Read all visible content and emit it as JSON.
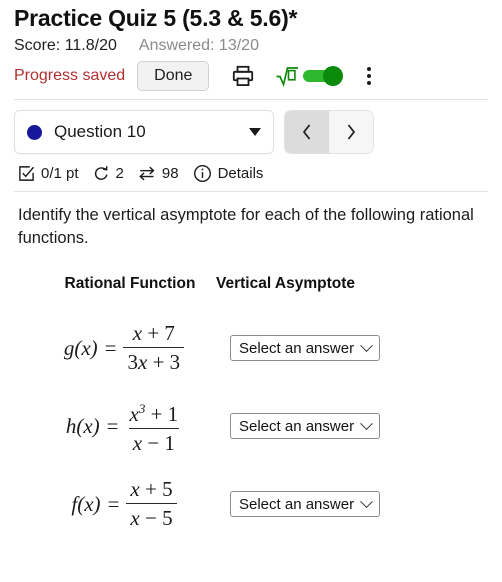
{
  "header": {
    "title": "Practice Quiz 5 (5.3 & 5.6)*",
    "score_label": "Score: 11.8/20",
    "answered_label": "Answered: 13/20",
    "progress_saved_label": "Progress saved",
    "done_label": "Done",
    "print_icon": "print-icon",
    "math_toggle": {
      "icon": "square-root-icon",
      "glyph": "√0",
      "state": "on",
      "color": "#0c8a0c"
    },
    "overflow_icon": "kebab-menu-icon",
    "colors": {
      "progress_saved": "#b03030",
      "answered": "#8a8a8a",
      "toggle_green": "#0c8a0c"
    }
  },
  "nav": {
    "question_label": "Question 10",
    "status_dot_color": "#16189c",
    "dropdown_icon": "caret-down-icon",
    "prev_label": "‹",
    "next_label": "›",
    "prev_icon": "chevron-left-icon",
    "next_icon": "chevron-right-icon"
  },
  "status_strip": {
    "points": "0/1 pt",
    "attempts": "2",
    "shuffles": "98",
    "details_label": "Details",
    "icons": {
      "points": "checkbox-check-icon",
      "attempts": "undo-retry-icon",
      "shuffles": "swap-arrows-icon",
      "details": "info-circle-icon"
    }
  },
  "question": {
    "prompt": "Identify the vertical asymptote for each of the following rational functions.",
    "columns": {
      "rational_function": "Rational Function",
      "vertical_asymptote": "Vertical Asymptote"
    },
    "rows": [
      {
        "name": "g",
        "lhs": "g(x)",
        "eq": "=",
        "numerator": "x + 7",
        "denominator": "3x + 3",
        "num_var": "x",
        "num_op": "+",
        "num_const": "7",
        "num_exp": "",
        "den_coef": "3",
        "den_var": "x",
        "den_op": "+",
        "den_const": "3",
        "answer": "Select an answer"
      },
      {
        "name": "h",
        "lhs": "h(x)",
        "eq": "=",
        "numerator": "x³ + 1",
        "denominator": "x − 1",
        "num_var": "x",
        "num_op": "+",
        "num_const": "1",
        "num_exp": "3",
        "den_coef": "",
        "den_var": "x",
        "den_op": "−",
        "den_const": "1",
        "answer": "Select an answer"
      },
      {
        "name": "f",
        "lhs": "f(x)",
        "eq": "=",
        "numerator": "x + 5",
        "denominator": "x − 5",
        "num_var": "x",
        "num_op": "+",
        "num_const": "5",
        "num_exp": "",
        "den_coef": "",
        "den_var": "x",
        "den_op": "−",
        "den_const": "5",
        "answer": "Select an answer"
      }
    ]
  }
}
